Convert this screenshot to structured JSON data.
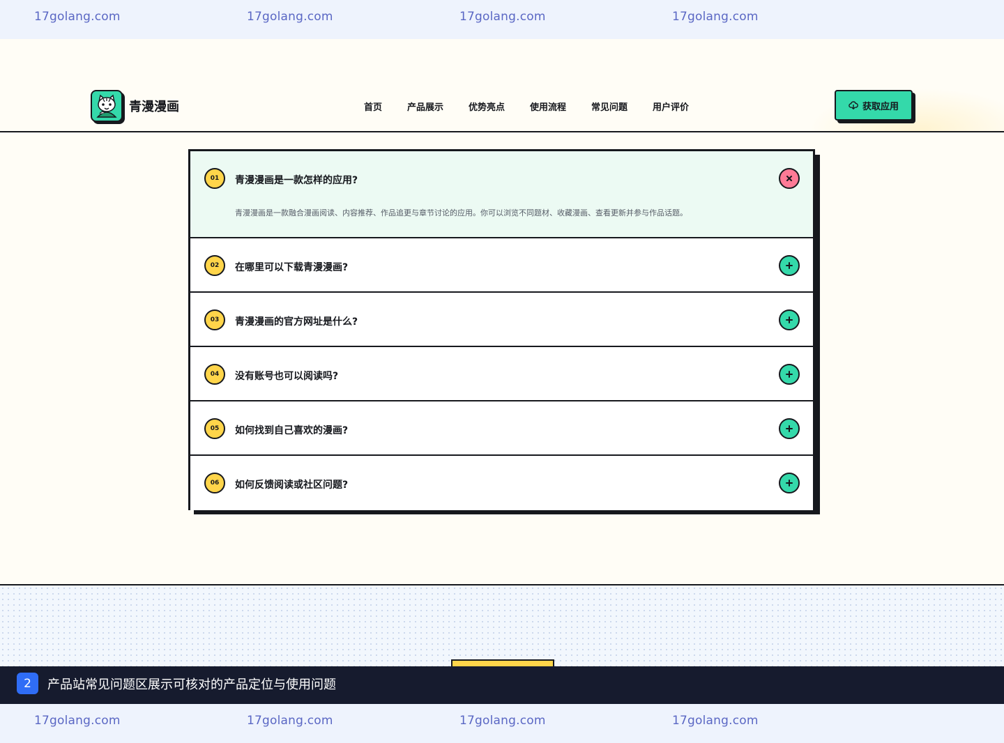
{
  "watermark": {
    "text": "17golang.com"
  },
  "header": {
    "brand": "青漫漫画",
    "nav": [
      "首页",
      "产品展示",
      "优势亮点",
      "使用流程",
      "常见问题",
      "用户评价"
    ],
    "cta_label": "获取应用"
  },
  "faq": {
    "items": [
      {
        "num": "01",
        "question": "青漫漫画是一款怎样的应用?",
        "answer": "青漫漫画是一款融合漫画阅读、内容推荐、作品追更与章节讨论的应用。你可以浏览不同题材、收藏漫画、查看更新并参与作品话题。",
        "expanded": true
      },
      {
        "num": "02",
        "question": "在哪里可以下载青漫漫画?",
        "expanded": false
      },
      {
        "num": "03",
        "question": "青漫漫画的官方网址是什么?",
        "expanded": false
      },
      {
        "num": "04",
        "question": "没有账号也可以阅读吗?",
        "expanded": false
      },
      {
        "num": "05",
        "question": "如何找到自己喜欢的漫画?",
        "expanded": false
      },
      {
        "num": "06",
        "question": "如何反馈阅读或社区问题?",
        "expanded": false
      }
    ]
  },
  "caption": {
    "index": "2",
    "text": "产品站常见问题区展示可核对的产品定位与使用问题"
  },
  "colors": {
    "accent_green": "#34d9aa",
    "accent_yellow": "#ffd54a",
    "accent_pink": "#ff7a96",
    "ink": "#16181d",
    "caption_bg": "#161b2e",
    "caption_badge": "#2f6df6"
  },
  "icons": {
    "logo": "cat-mascot-icon",
    "cta": "cloud-download-icon",
    "expanded": "close-icon",
    "collapsed": "plus-icon"
  }
}
